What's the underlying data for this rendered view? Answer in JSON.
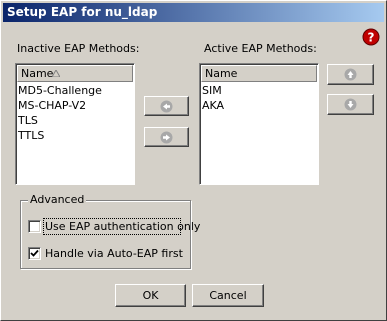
{
  "window": {
    "title": "Setup EAP for nu_ldap"
  },
  "help_icon": {
    "name": "help-icon",
    "color": "#c00000"
  },
  "inactive": {
    "label": "Inactive EAP Methods:",
    "column_header": "Name",
    "items": [
      "MD5-Challenge",
      "MS-CHAP-V2",
      "TLS",
      "TTLS"
    ]
  },
  "active": {
    "label": "Active EAP Methods:",
    "column_header": "Name",
    "items": [
      "SIM",
      "AKA"
    ]
  },
  "transfer_buttons": {
    "move_left_icon": "arrow-left-icon",
    "move_right_icon": "arrow-right-icon"
  },
  "order_buttons": {
    "move_up_icon": "arrow-up-icon",
    "move_down_icon": "arrow-down-icon"
  },
  "advanced": {
    "legend": "Advanced",
    "options": [
      {
        "label": "Use EAP authentication only",
        "checked": false
      },
      {
        "label": "Handle via Auto-EAP first",
        "checked": true
      }
    ]
  },
  "footer": {
    "ok_label": "OK",
    "cancel_label": "Cancel"
  }
}
